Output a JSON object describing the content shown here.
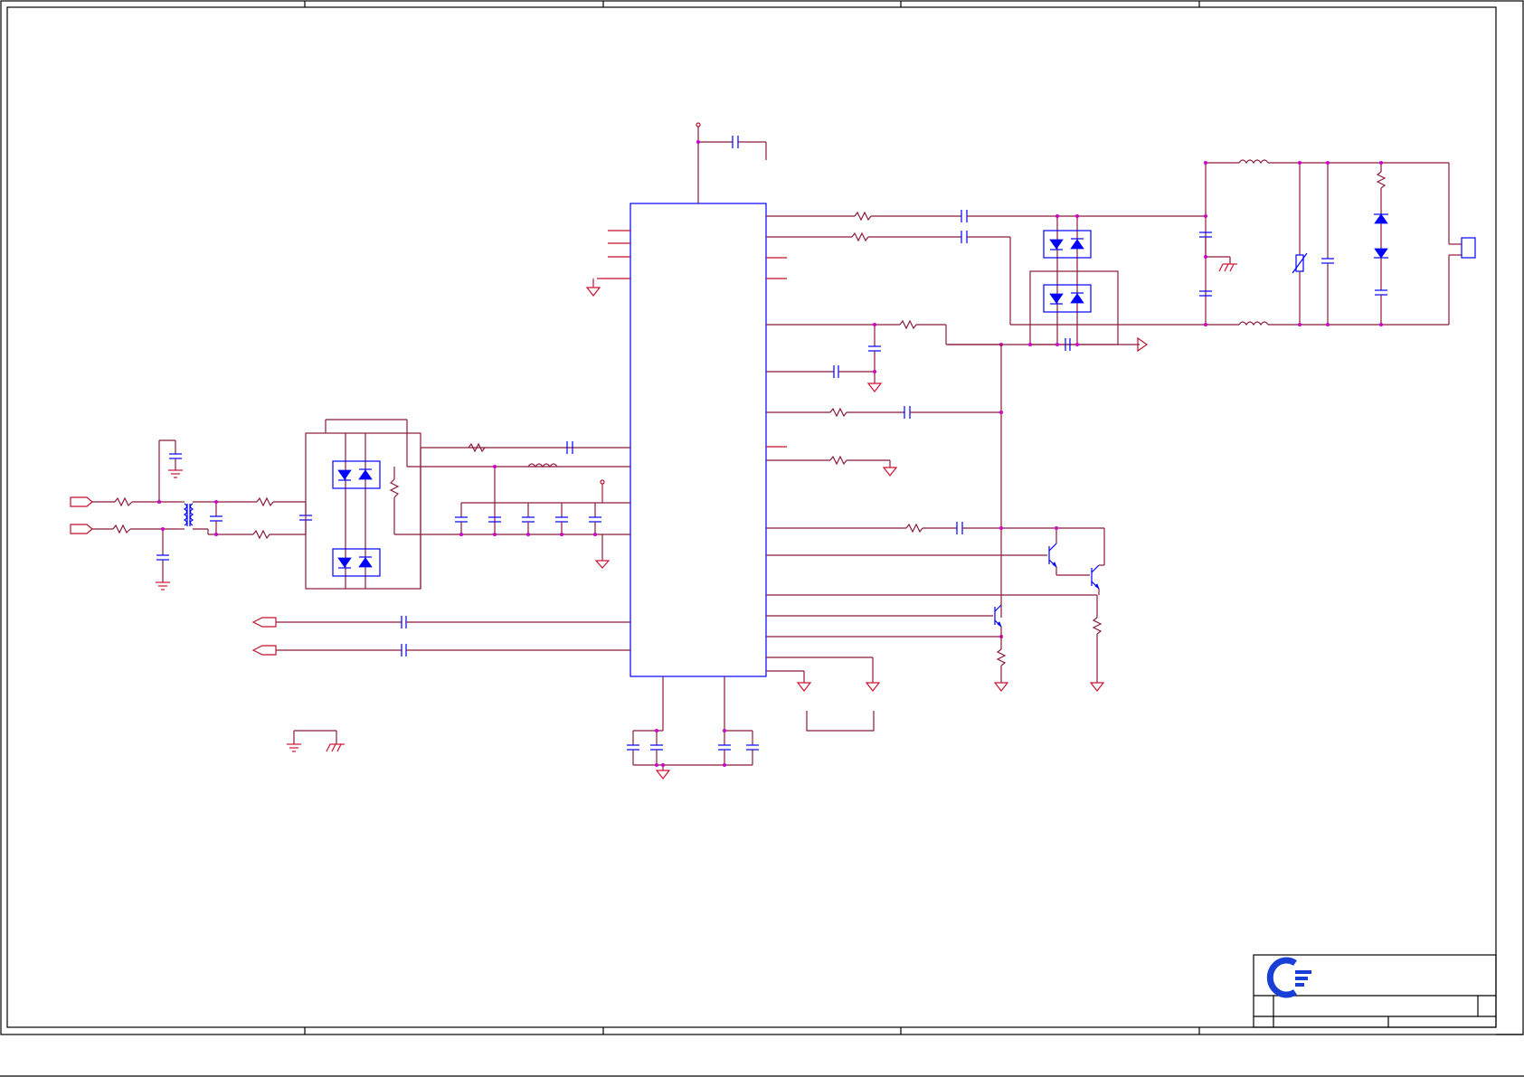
{
  "sheet": {
    "frame_color": "#000000",
    "wire_color": "#8b1a3a",
    "component_color": "#0000ff",
    "pin_color": "#c0102e",
    "junction_color": "#cc00cc"
  },
  "title_block": {
    "logo_icon": "company-logo-icon",
    "logo_color": "#1a3fd6"
  },
  "components": {
    "main_ic": "ic-u1",
    "optocouplers": 4,
    "transistors": 3,
    "connector": "output-connector-j1"
  }
}
